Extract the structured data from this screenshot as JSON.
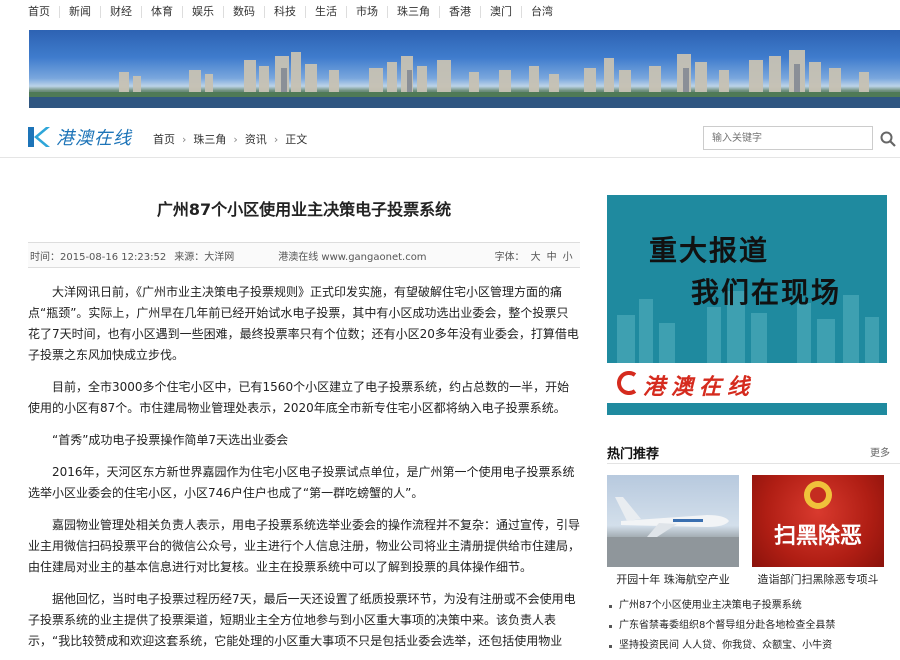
{
  "topnav": [
    "首页",
    "新闻",
    "财经",
    "体育",
    "娱乐",
    "数码",
    "科技",
    "生活",
    "市场",
    "珠三角",
    "香港",
    "澳门",
    "台湾"
  ],
  "site": {
    "logo_text": "港澳在线",
    "breadcrumb": [
      "首页",
      "珠三角",
      "资讯",
      "正文"
    ],
    "search_placeholder": "输入关键字",
    "brand_color": "#1d74b8"
  },
  "article": {
    "title": "广州87个小区使用业主决策电子投票系统",
    "time": "时间：2015-08-16 12:23:52",
    "source": "来源：大洋网",
    "site_label": "港澳在线 www.gangaonet.com",
    "font_label": "字体：",
    "font_sizes": [
      "大",
      "中",
      "小"
    ],
    "paragraphs": [
      "大洋网讯日前，《广州市业主决策电子投票规则》正式印发实施，有望破解住宅小区管理方面的痛点“瓶颈”。实际上，广州早在几年前已经开始试水电子投票，其中有小区成功选出业委会，整个投票只花了7天时间，也有小区遇到一些困难，最终投票率只有个位数；还有小区20多年没有业委会，打算借电子投票之东风加快成立步伐。",
      "目前，全市3000多个住宅小区中，已有1560个小区建立了电子投票系统，约占总数的一半，开始使用的小区有87个。市住建局物业管理处表示，2020年底全市新专住宅小区都将纳入电子投票系统。",
      "“首秀”成功电子投票操作简单7天选出业委会",
      "2016年，天河区东方新世界嘉园作为住宅小区电子投票试点单位，是广州第一个使用电子投票系统选举小区业委会的住宅小区，小区746户住户也成了“第一群吃螃蟹的人”。",
      "嘉园物业管理处相关负责人表示，用电子投票系统选举业委会的操作流程并不复杂：通过宣传，引导业主用微信扫码投票平台的微信公众号，业主进行个人信息注册，物业公司将业主清册提供给市住建局，由住建局对业主的基本信息进行对比复核。业主在投票系统中可以了解到投票的具体操作细节。",
      "据他回忆，当时电子投票过程历经7天，最后一天还设置了纸质投票环节，为没有注册或不会使用电子投票系统的业主提供了投票渠道，短期业主全方位地参与到小区重大事项的决策中来。该负责人表示，“我比较赞成和欢迎这套系统，它能处理的小区重大事项不只是包括业委会选举，还包括使用物业"
    ]
  },
  "ad": {
    "line1": "重大报道",
    "line2": "我们在现场",
    "logo_text": "港澳在线",
    "bg_color": "#1f8a9f"
  },
  "hot": {
    "heading": "热门推荐",
    "more": "更多",
    "thumbs": [
      {
        "caption": "开园十年 珠海航空产业",
        "icon": "airplane-icon"
      },
      {
        "caption": "造诣部门扫黑除恶专项斗",
        "icon": "police-emblem-icon",
        "badge": "扫黑除恶"
      }
    ],
    "list": [
      "广州87个小区使用业主决策电子投票系统",
      "广东省禁毒委组织8个督导组分赴各地检查全县禁",
      "坚持投资民间 人人贷、你我贷、众额宝、小牛资"
    ]
  }
}
